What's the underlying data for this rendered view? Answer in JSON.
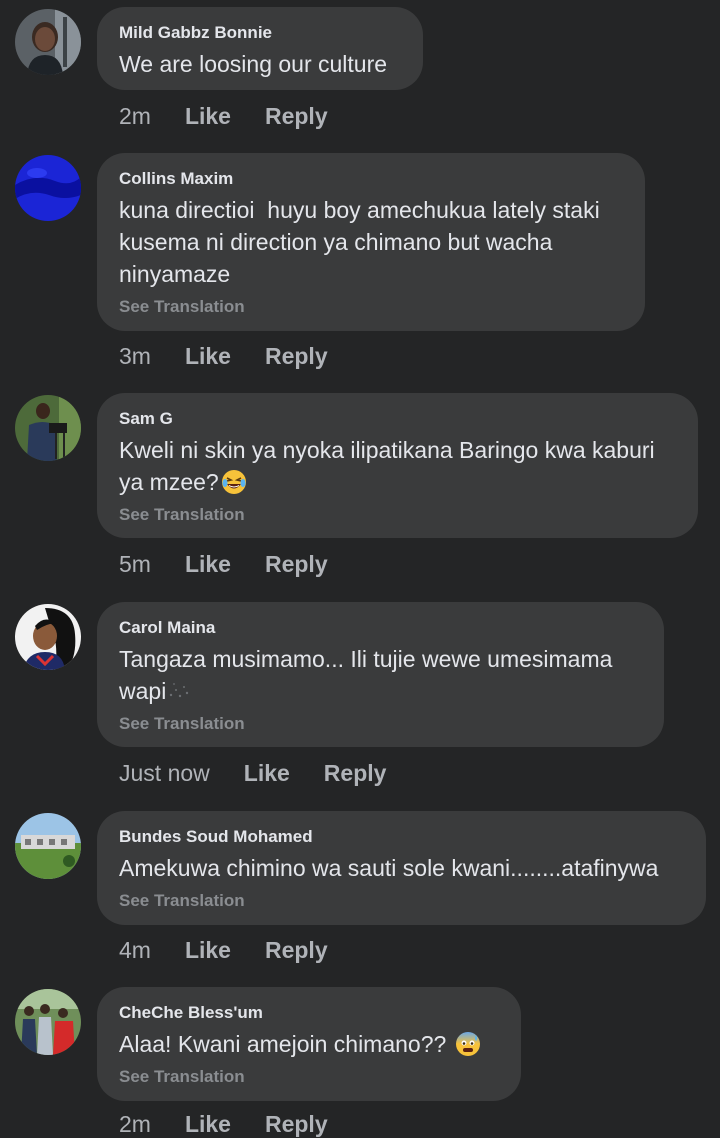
{
  "colors": {
    "background": "#242526",
    "bubble": "#3a3b3c",
    "text": "#e4e6eb",
    "muted": "#b0b3b8"
  },
  "comments": [
    {
      "author": "Mild Gabbz Bonnie",
      "text": "We are loosing our culture",
      "see_translation": "",
      "time": "2m",
      "like": "Like",
      "reply": "Reply",
      "avatar_icon": "woman-portrait-avatar"
    },
    {
      "author": "Collins Maxim",
      "text": "kuna directioi  huyu boy amechukua lately staki kusema ni direction ya chimano but wacha ninyamaze",
      "see_translation": "See Translation",
      "time": "3m",
      "like": "Like",
      "reply": "Reply",
      "avatar_icon": "blue-abstract-avatar"
    },
    {
      "author": "Sam G",
      "text": "Kweli ni skin ya nyoka ilipatikana Baringo kwa kaburi ya mzee?",
      "see_translation": "See Translation",
      "time": "5m",
      "like": "Like",
      "reply": "Reply",
      "avatar_icon": "camera-man-avatar",
      "emoji": "laughing-crying-emoji"
    },
    {
      "author": "Carol Maina",
      "text": "Tangaza musimamo... Ili tujie wewe umesimama wapi",
      "see_translation": "See Translation",
      "time": "Just now",
      "like": "Like",
      "reply": "Reply",
      "avatar_icon": "cartoon-woman-avatar",
      "emoji": "sparkle-emoji"
    },
    {
      "author": "Bundes Soud Mohamed",
      "text": "Amekuwa chimino wa sauti sole kwani........atafinywa",
      "see_translation": "See Translation",
      "time": "4m",
      "like": "Like",
      "reply": "Reply",
      "avatar_icon": "landscape-avatar"
    },
    {
      "author": "CheChe Bless'um",
      "text": "Alaa! Kwani amejoin chimano??",
      "see_translation": "See Translation",
      "time": "2m",
      "like": "Like",
      "reply": "Reply",
      "avatar_icon": "group-photo-avatar",
      "emoji": "anxious-sweat-emoji"
    }
  ]
}
